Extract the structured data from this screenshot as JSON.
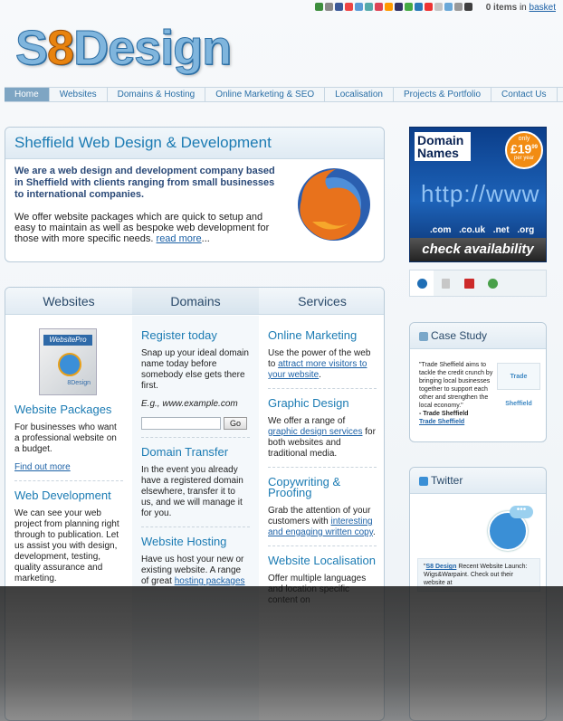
{
  "topbar": {
    "basket_count": "0 items",
    "basket_in": "in",
    "basket_link": "basket",
    "social_colors": [
      "#3d8e3d",
      "#888",
      "#3b5998",
      "#e44",
      "#5b9bd5",
      "#5aa",
      "#d45",
      "#f90",
      "#336",
      "#4a4",
      "#2a7ab8",
      "#e33",
      "#c4c4c4",
      "#6aa8d8",
      "#999",
      "#3f3f3f"
    ]
  },
  "logo": {
    "s": "S",
    "eight": "8",
    "rest": "Design"
  },
  "nav": [
    "Home",
    "Websites",
    "Domains & Hosting",
    "Online Marketing & SEO",
    "Localisation",
    "Projects & Portfolio",
    "Contact Us"
  ],
  "intro": {
    "title": "Sheffield Web Design & Development",
    "lead": "We are a web design and development company based in Sheffield with clients ranging from small businesses to international companies.",
    "body": "We offer website packages which are quick to setup and easy to maintain as well as bespoke web development for those with more specific needs.",
    "read_more": "read more",
    "ellipsis": "..."
  },
  "domain_ad": {
    "title": "Domain Names",
    "badge_only": "only",
    "badge_price": "£19",
    "badge_suffix": "99",
    "badge_per": "per year",
    "url_text": "http://www",
    "tlds": ".com .co.uk .net .org",
    "check": "check availability"
  },
  "flags": [
    "#1f6eb5",
    "#c7c7c7",
    "#cc2a2a",
    "#49a04a"
  ],
  "columns": {
    "headers": [
      "Websites",
      "Domains",
      "Services"
    ],
    "websites": {
      "box_label": "WebsitePro",
      "box_side": "8Design",
      "h1": "Website Packages",
      "p1": "For businesses who want a professional website on a budget.",
      "link1": "Find out more",
      "h2": "Web Development",
      "p2": "We can see your web project from planning right through to publication. Let us assist you with design, development, testing, quality assurance and marketing."
    },
    "domains": {
      "h1": "Register today",
      "p1": "Snap up your ideal domain name today before somebody else gets there first.",
      "example": "E.g., www.example.com",
      "go": "Go",
      "h2": "Domain Transfer",
      "p2": "In the event you already have a registered domain elsewhere, transfer it to us, and we will manage it for you.",
      "h3": "Website Hosting",
      "p3a": "Have us host your new or existing website. A range of great",
      "p3link": "hosting packages"
    },
    "services": {
      "h1": "Online Marketing",
      "p1a": "Use the power of the web to",
      "p1link": "attract more visitors to your website",
      "p1b": ".",
      "h2": "Graphic Design",
      "p2a": "We offer a range of",
      "p2link": "graphic design services",
      "p2b": "for both websites and traditional media.",
      "h3": "Copywriting & Proofing",
      "p3a": "Grab the attention of your customers with",
      "p3link": "interesting and engaging written copy",
      "p3b": ".",
      "h4": "Website Localisation",
      "p4": "Offer multiple languages and location specific content on"
    }
  },
  "case_study": {
    "title": "Case Study",
    "quote": "\"Trade Sheffield aims to tackle the credit crunch by bringing local businesses together to support each other and strengthen the local economy.\"",
    "author": "- Trade Sheffield",
    "link": "Trade Sheffield",
    "logo_text": "Trade Sheffield"
  },
  "twitter": {
    "title": "Twitter",
    "bubble": "•••",
    "tweet_link": "S8 Design",
    "tweet_text": "Recent Website Launch: Wigs&Warpaint. Check out their website at"
  }
}
